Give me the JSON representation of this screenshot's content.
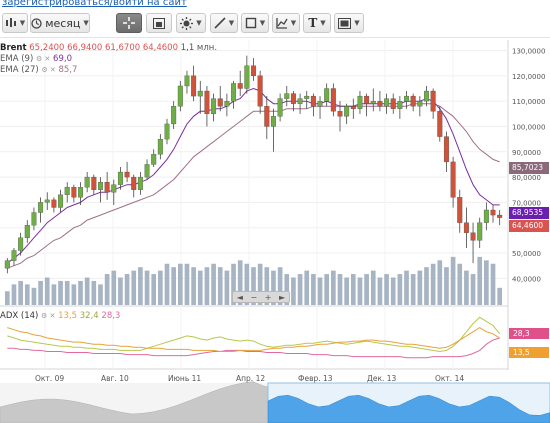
{
  "top_link": "зарегистрироваться/войти на сайт",
  "toolbar": {
    "period_label": "месяц",
    "icons": [
      "candle-chart-type-icon",
      "clock-icon",
      "crosshair-icon",
      "bar-style-icon",
      "indicators-icon",
      "draw-line-icon",
      "shape-icon",
      "chart-tools-icon",
      "text-icon",
      "screen-layout-icon"
    ]
  },
  "legend": {
    "symbol": "Brent",
    "open": "65,2400",
    "high": "66,9400",
    "low": "61,6700",
    "close": "64,4600",
    "volume": "1,1 млн.",
    "ema9_label": "EMA (9)",
    "ema9_value": "69,0",
    "ema27_label": "EMA (27)",
    "ema27_value": "85,7"
  },
  "price_axis": {
    "ticks": [
      "130,0000",
      "120,0000",
      "110,0000",
      "100,0000",
      "90,0000",
      "80,0000",
      "70,0000",
      "60,0000",
      "50,0000",
      "40,0000"
    ],
    "ema27_tag": "85,7023",
    "ema9_tag": "68,9535",
    "last_price_tag": "64,4600"
  },
  "adx": {
    "label": "ADX (14)",
    "adx_value": "13,5",
    "plus_di_value": "32,4",
    "minus_di_value": "28,3",
    "tag_minus_di": "28,3",
    "tag_adx": "13,5"
  },
  "x_axis": {
    "labels": [
      "Окт. 09",
      "Авг. 10",
      "Июнь 11",
      "Апр. 12",
      "Февр. 13",
      "Дек. 13",
      "Окт. 14"
    ]
  },
  "colors": {
    "up": "#6fae46",
    "down": "#d0523a",
    "ema9": "#7b2fa0",
    "ema27": "#a0708a",
    "volume": "#a7b4c3",
    "adx": "#e8a23a",
    "plus_di": "#b8c84a",
    "minus_di": "#e06aa0",
    "navigator": "#4fa3e8"
  },
  "chart_data": {
    "type": "candlestick",
    "ylim": [
      35,
      131
    ],
    "candles": [
      [
        44,
        48,
        42,
        47
      ],
      [
        47,
        52,
        45,
        51
      ],
      [
        51,
        58,
        49,
        56
      ],
      [
        56,
        63,
        54,
        61
      ],
      [
        61,
        68,
        59,
        66
      ],
      [
        66,
        72,
        62,
        70
      ],
      [
        70,
        74,
        67,
        71
      ],
      [
        71,
        72,
        66,
        68
      ],
      [
        68,
        75,
        66,
        73
      ],
      [
        73,
        78,
        70,
        76
      ],
      [
        76,
        77,
        70,
        72
      ],
      [
        72,
        78,
        69,
        76
      ],
      [
        76,
        82,
        74,
        80
      ],
      [
        80,
        81,
        73,
        75
      ],
      [
        75,
        80,
        70,
        78
      ],
      [
        78,
        82,
        71,
        74
      ],
      [
        74,
        79,
        69,
        77
      ],
      [
        77,
        84,
        75,
        82
      ],
      [
        82,
        86,
        78,
        80
      ],
      [
        80,
        81,
        72,
        75
      ],
      [
        75,
        82,
        73,
        80
      ],
      [
        80,
        87,
        79,
        85
      ],
      [
        85,
        91,
        84,
        89
      ],
      [
        89,
        97,
        87,
        95
      ],
      [
        95,
        103,
        93,
        101
      ],
      [
        101,
        110,
        99,
        108
      ],
      [
        108,
        118,
        106,
        116
      ],
      [
        116,
        122,
        113,
        120
      ],
      [
        120,
        124,
        110,
        112
      ],
      [
        112,
        118,
        105,
        114
      ],
      [
        114,
        116,
        100,
        105
      ],
      [
        105,
        113,
        102,
        111
      ],
      [
        111,
        116,
        106,
        108
      ],
      [
        108,
        113,
        104,
        110
      ],
      [
        110,
        118,
        107,
        117
      ],
      [
        117,
        122,
        112,
        115
      ],
      [
        115,
        128,
        113,
        124
      ],
      [
        124,
        127,
        118,
        120
      ],
      [
        120,
        122,
        105,
        108
      ],
      [
        108,
        112,
        95,
        100
      ],
      [
        100,
        107,
        90,
        104
      ],
      [
        104,
        113,
        102,
        111
      ],
      [
        111,
        116,
        108,
        113
      ],
      [
        113,
        114,
        106,
        109
      ],
      [
        109,
        113,
        105,
        111
      ],
      [
        111,
        114,
        107,
        112
      ],
      [
        112,
        113,
        104,
        108
      ],
      [
        108,
        112,
        103,
        110
      ],
      [
        110,
        117,
        108,
        115
      ],
      [
        115,
        117,
        104,
        106
      ],
      [
        106,
        110,
        98,
        104
      ],
      [
        104,
        109,
        101,
        108
      ],
      [
        108,
        111,
        103,
        107
      ],
      [
        107,
        114,
        105,
        112
      ],
      [
        112,
        113,
        104,
        109
      ],
      [
        109,
        115,
        106,
        110
      ],
      [
        110,
        114,
        106,
        108
      ],
      [
        108,
        113,
        105,
        111
      ],
      [
        111,
        113,
        105,
        107
      ],
      [
        107,
        112,
        103,
        110
      ],
      [
        110,
        114,
        107,
        112
      ],
      [
        112,
        113,
        106,
        108
      ],
      [
        108,
        112,
        104,
        110
      ],
      [
        110,
        116,
        108,
        114
      ],
      [
        114,
        115,
        103,
        106
      ],
      [
        106,
        108,
        94,
        96
      ],
      [
        96,
        98,
        82,
        86
      ],
      [
        86,
        88,
        68,
        72
      ],
      [
        72,
        75,
        58,
        62
      ],
      [
        62,
        68,
        52,
        58
      ],
      [
        58,
        62,
        46,
        55
      ],
      [
        55,
        64,
        52,
        62
      ],
      [
        62,
        70,
        59,
        67
      ],
      [
        67,
        69,
        62,
        65
      ],
      [
        65,
        67,
        61,
        64
      ]
    ],
    "volumes": [
      4,
      6,
      7,
      6,
      5,
      7,
      8,
      6,
      7,
      7,
      6,
      7,
      8,
      7,
      6,
      9,
      10,
      8,
      9,
      10,
      11,
      10,
      9,
      10,
      12,
      11,
      12,
      12,
      11,
      10,
      11,
      12,
      11,
      10,
      12,
      13,
      12,
      11,
      12,
      11,
      10,
      11,
      9,
      8,
      9,
      10,
      9,
      8,
      9,
      10,
      9,
      8,
      9,
      8,
      9,
      10,
      8,
      9,
      8,
      9,
      10,
      9,
      10,
      11,
      12,
      13,
      11,
      14,
      12,
      10,
      9,
      14,
      13,
      12,
      5
    ],
    "ema9": [
      46,
      48,
      50,
      53,
      56,
      59,
      62,
      64,
      66,
      68,
      69,
      70,
      72,
      73,
      74,
      74,
      75,
      76,
      77,
      77,
      78,
      79,
      81,
      84,
      87,
      91,
      96,
      101,
      104,
      106,
      106,
      107,
      107,
      108,
      110,
      111,
      114,
      115,
      114,
      111,
      109,
      109,
      110,
      110,
      110,
      110,
      109,
      109,
      110,
      109,
      108,
      108,
      108,
      109,
      109,
      109,
      109,
      109,
      109,
      109,
      110,
      110,
      110,
      111,
      110,
      107,
      103,
      97,
      90,
      83,
      77,
      73,
      71,
      69,
      69
    ],
    "ema27": [
      44,
      45,
      46,
      48,
      49,
      51,
      53,
      55,
      56,
      58,
      60,
      61,
      63,
      64,
      65,
      66,
      67,
      68,
      69,
      70,
      71,
      72,
      73,
      75,
      77,
      79,
      82,
      85,
      88,
      90,
      92,
      94,
      96,
      98,
      100,
      102,
      104,
      106,
      106,
      106,
      106,
      106,
      107,
      107,
      107,
      107,
      108,
      108,
      108,
      108,
      108,
      108,
      108,
      108,
      108,
      108,
      108,
      108,
      108,
      108,
      108,
      109,
      109,
      109,
      109,
      108,
      106,
      104,
      101,
      98,
      94,
      91,
      89,
      87,
      86
    ],
    "adx_series": [
      38,
      36,
      34,
      33,
      31,
      30,
      28,
      27,
      26,
      25,
      24,
      24,
      23,
      22,
      22,
      21,
      21,
      20,
      20,
      19,
      19,
      18,
      18,
      18,
      17,
      17,
      17,
      17,
      16,
      16,
      16,
      16,
      15,
      15,
      15,
      16,
      16,
      16,
      16,
      17,
      18,
      18,
      19,
      19,
      20,
      20,
      21,
      22,
      22,
      23,
      24,
      24,
      25,
      25,
      26,
      26,
      25,
      25,
      24,
      23,
      22,
      22,
      21,
      20,
      19,
      18,
      19,
      22,
      26,
      30,
      34,
      38,
      34,
      32,
      28
    ],
    "plus_di_series": [
      30,
      28,
      26,
      25,
      24,
      23,
      22,
      21,
      20,
      20,
      19,
      19,
      18,
      18,
      17,
      17,
      17,
      16,
      16,
      16,
      16,
      18,
      20,
      22,
      24,
      26,
      28,
      30,
      29,
      27,
      26,
      28,
      29,
      27,
      26,
      25,
      26,
      25,
      22,
      20,
      19,
      20,
      21,
      21,
      22,
      23,
      23,
      24,
      25,
      24,
      23,
      22,
      23,
      24,
      25,
      24,
      23,
      22,
      21,
      20,
      20,
      19,
      18,
      17,
      16,
      15,
      16,
      20,
      26,
      34,
      42,
      48,
      44,
      40,
      32
    ],
    "minus_di_series": [
      18,
      18,
      17,
      17,
      16,
      16,
      15,
      15,
      15,
      14,
      14,
      14,
      14,
      13,
      13,
      13,
      13,
      13,
      12,
      12,
      12,
      12,
      11,
      11,
      11,
      11,
      11,
      11,
      12,
      13,
      14,
      15,
      15,
      16,
      16,
      16,
      15,
      15,
      15,
      14,
      14,
      14,
      13,
      13,
      13,
      13,
      12,
      12,
      12,
      11,
      11,
      11,
      10,
      10,
      10,
      10,
      10,
      10,
      10,
      10,
      9,
      9,
      9,
      9,
      10,
      10,
      10,
      10,
      10,
      11,
      13,
      16,
      22,
      26,
      28
    ]
  }
}
